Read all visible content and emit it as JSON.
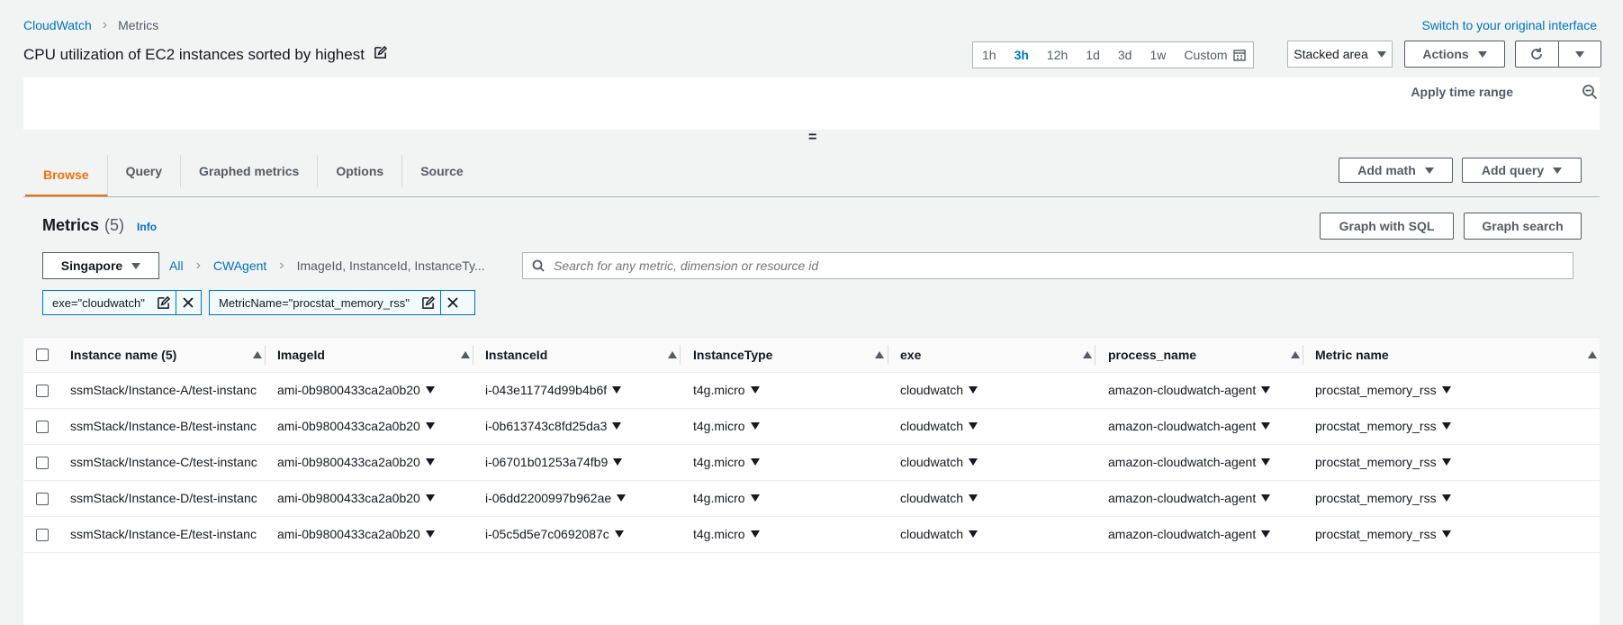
{
  "breadcrumb": {
    "root": "CloudWatch",
    "current": "Metrics"
  },
  "switch_interface": "Switch to your original interface",
  "title": "CPU utilization of EC2 instances sorted by highest",
  "time_range": {
    "options": [
      "1h",
      "3h",
      "12h",
      "1d",
      "3d",
      "1w"
    ],
    "selected": "3h",
    "custom_label": "Custom"
  },
  "graph_type": "Stacked area",
  "actions_label": "Actions",
  "apply_time_range": "Apply time range",
  "tabs": [
    "Browse",
    "Query",
    "Graphed metrics",
    "Options",
    "Source"
  ],
  "active_tab": "Browse",
  "add_math": "Add math",
  "add_query": "Add query",
  "metrics": {
    "heading": "Metrics",
    "count": "(5)",
    "info": "Info",
    "graph_with_sql": "Graph with SQL",
    "graph_search": "Graph search",
    "region": "Singapore",
    "ns_all": "All",
    "ns_namespace": "CWAgent",
    "ns_dimensions": "ImageId, InstanceId, InstanceTy...",
    "search_placeholder": "Search for any metric, dimension or resource id",
    "filters": [
      "exe=\"cloudwatch\"",
      "MetricName=\"procstat_memory_rss\""
    ]
  },
  "table": {
    "columns": [
      "Instance name (5)",
      "ImageId",
      "InstanceId",
      "InstanceType",
      "exe",
      "process_name",
      "Metric name"
    ],
    "rows": [
      [
        "ssmStack/Instance-A/test-instanc",
        "ami-0b9800433ca2a0b20",
        "i-043e11774d99b4b6f",
        "t4g.micro",
        "cloudwatch",
        "amazon-cloudwatch-agent",
        "procstat_memory_rss"
      ],
      [
        "ssmStack/Instance-B/test-instanc",
        "ami-0b9800433ca2a0b20",
        "i-0b613743c8fd25da3",
        "t4g.micro",
        "cloudwatch",
        "amazon-cloudwatch-agent",
        "procstat_memory_rss"
      ],
      [
        "ssmStack/Instance-C/test-instanc",
        "ami-0b9800433ca2a0b20",
        "i-06701b01253a74fb9",
        "t4g.micro",
        "cloudwatch",
        "amazon-cloudwatch-agent",
        "procstat_memory_rss"
      ],
      [
        "ssmStack/Instance-D/test-instanc",
        "ami-0b9800433ca2a0b20",
        "i-06dd2200997b962ae",
        "t4g.micro",
        "cloudwatch",
        "amazon-cloudwatch-agent",
        "procstat_memory_rss"
      ],
      [
        "ssmStack/Instance-E/test-instanc",
        "ami-0b9800433ca2a0b20",
        "i-05c5d5e7c0692087c",
        "t4g.micro",
        "cloudwatch",
        "amazon-cloudwatch-agent",
        "procstat_memory_rss"
      ]
    ]
  },
  "colors": {
    "link": "#0073bb",
    "active_tab": "#ec7211",
    "text": "#16191f",
    "muted": "#545b64"
  },
  "icons": [
    "edit-icon",
    "calendar-icon",
    "refresh-icon",
    "zoom-out-icon",
    "search-icon",
    "close-icon",
    "sort-icon",
    "dropdown-icon"
  ]
}
